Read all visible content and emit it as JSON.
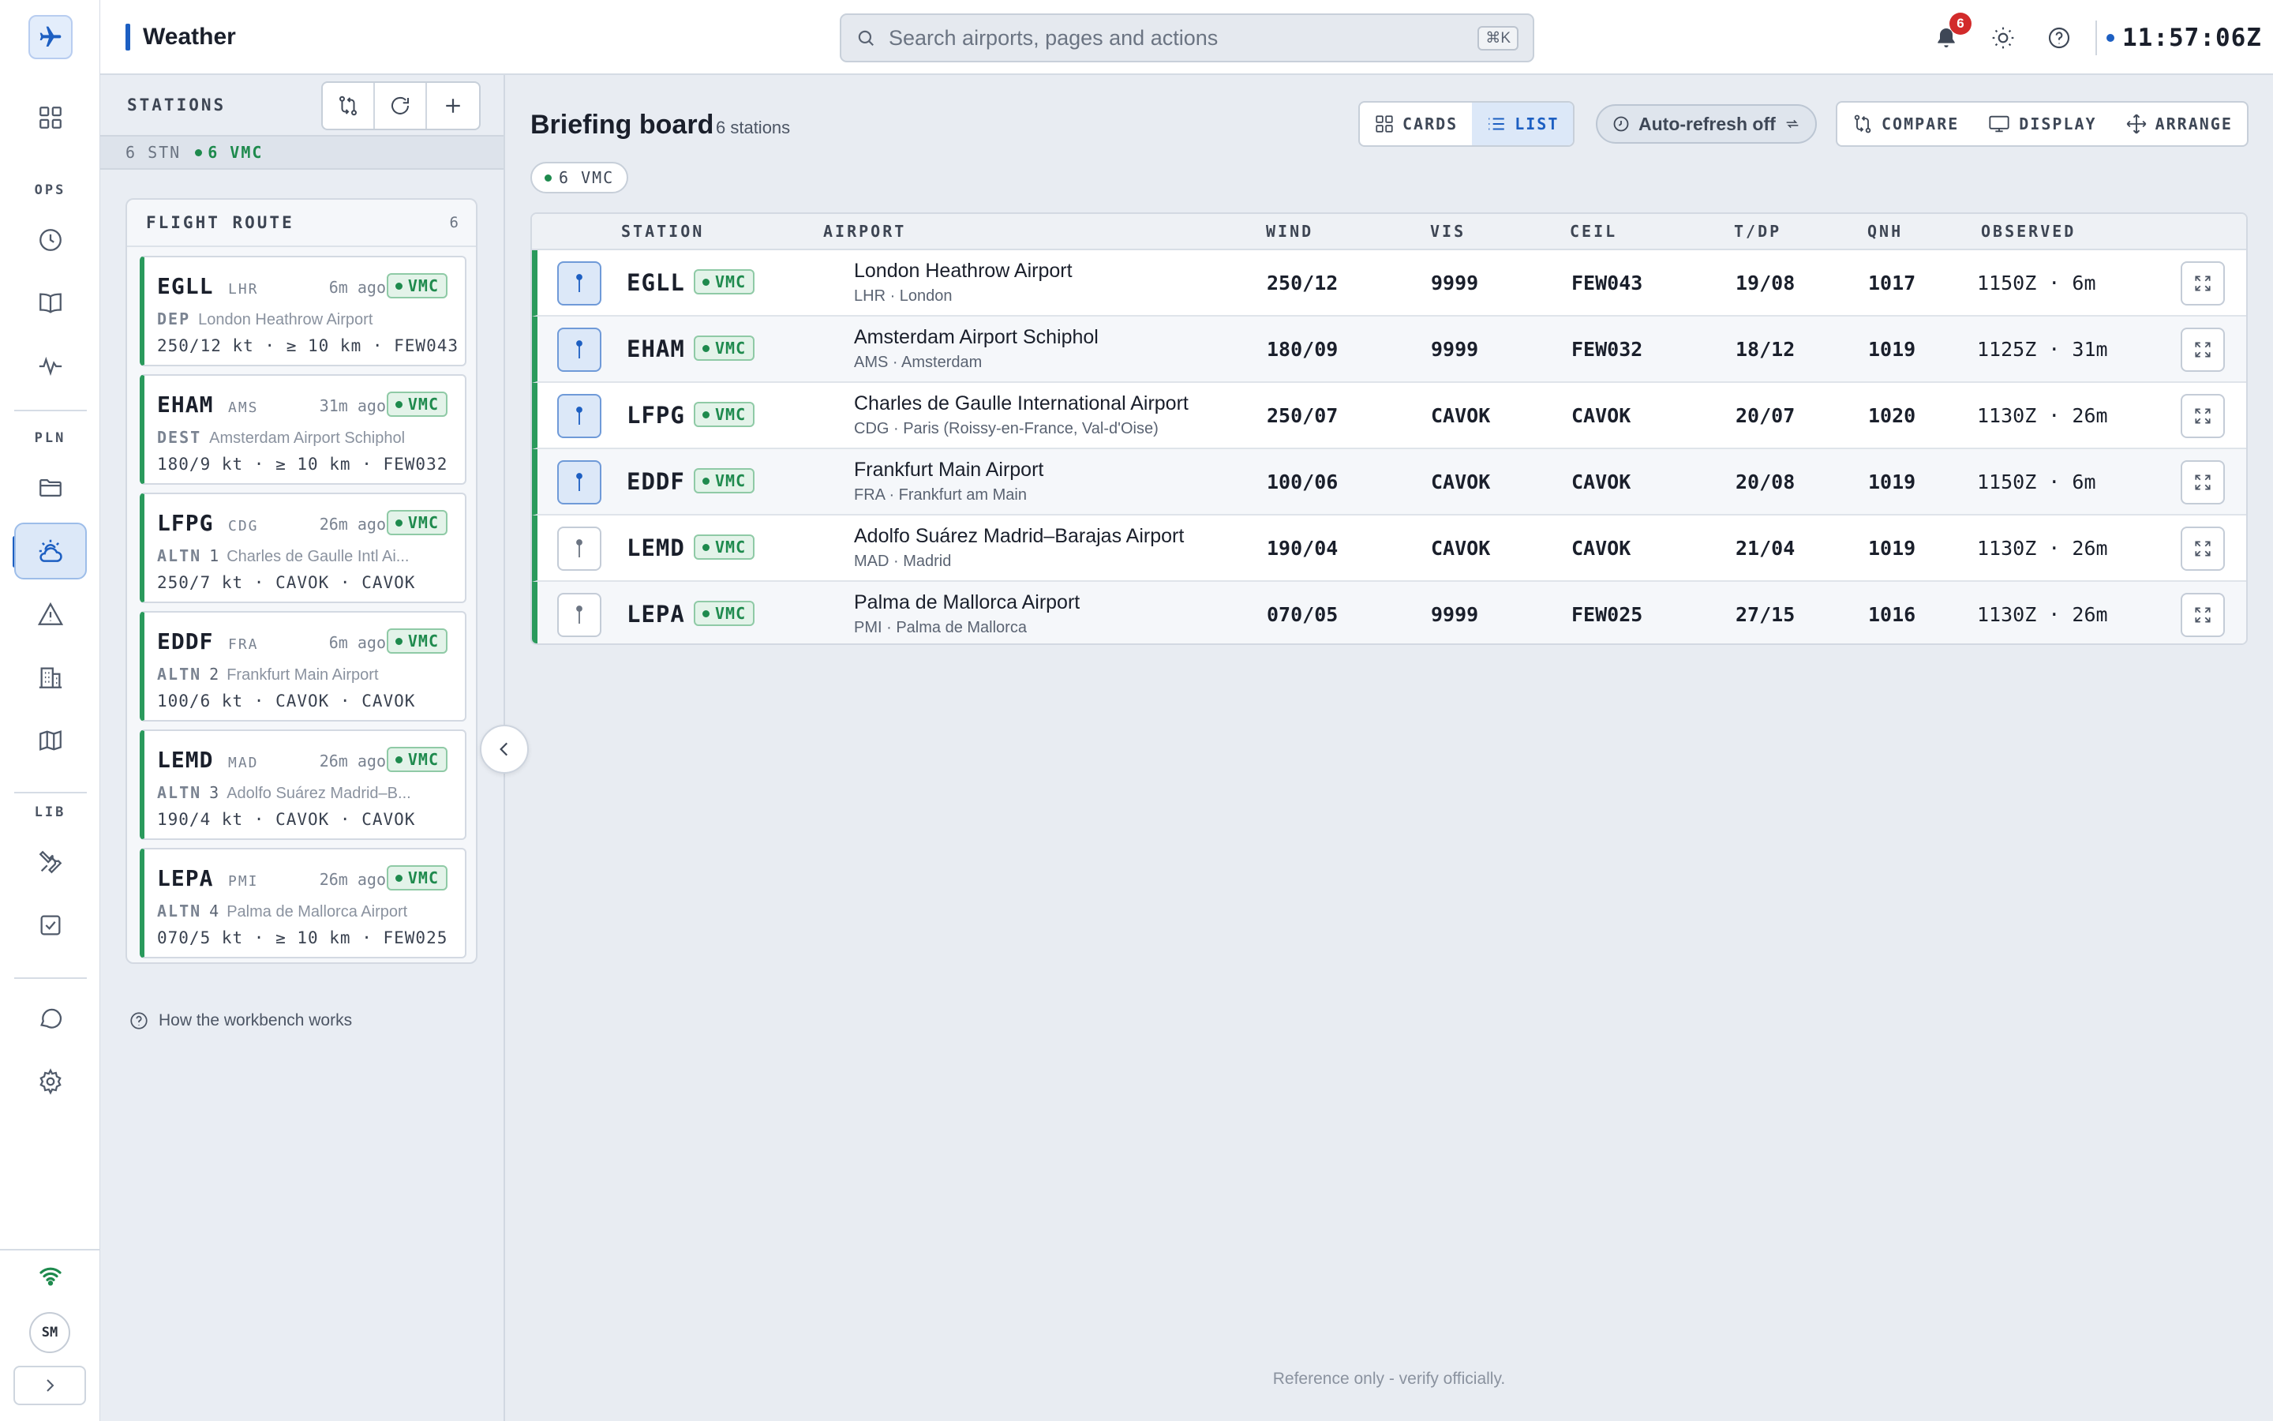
{
  "app": {
    "title": "Weather",
    "clock": "11:57:06Z",
    "notifications": "6"
  },
  "search": {
    "placeholder": "Search airports, pages and actions",
    "shortcut": "⌘K"
  },
  "rail": {
    "sections": [
      "OPS",
      "PLN",
      "LIB"
    ],
    "avatar": "SM"
  },
  "stations_panel": {
    "title": "STATIONS",
    "summary_count": "6 STN",
    "summary_vmc": "6 VMC",
    "route_title": "FLIGHT ROUTE",
    "route_count": "6",
    "help": "How the workbench works"
  },
  "route": [
    {
      "icao": "EGLL",
      "iata": "LHR",
      "ago": "6m ago",
      "cat": "VMC",
      "role": "DEP",
      "num": "",
      "name": "London Heathrow Airport",
      "met": "250/12 kt · ≥ 10 km · FEW043"
    },
    {
      "icao": "EHAM",
      "iata": "AMS",
      "ago": "31m ago",
      "cat": "VMC",
      "role": "DEST",
      "num": "",
      "name": "Amsterdam Airport Schiphol",
      "met": "180/9 kt · ≥ 10 km · FEW032"
    },
    {
      "icao": "LFPG",
      "iata": "CDG",
      "ago": "26m ago",
      "cat": "VMC",
      "role": "ALTN",
      "num": "1",
      "name": "Charles de Gaulle Intl Ai...",
      "met": "250/7 kt · CAVOK · CAVOK"
    },
    {
      "icao": "EDDF",
      "iata": "FRA",
      "ago": "6m ago",
      "cat": "VMC",
      "role": "ALTN",
      "num": "2",
      "name": "Frankfurt Main Airport",
      "met": "100/6 kt · CAVOK · CAVOK"
    },
    {
      "icao": "LEMD",
      "iata": "MAD",
      "ago": "26m ago",
      "cat": "VMC",
      "role": "ALTN",
      "num": "3",
      "name": "Adolfo Suárez Madrid–B...",
      "met": "190/4 kt · CAVOK · CAVOK"
    },
    {
      "icao": "LEPA",
      "iata": "PMI",
      "ago": "26m ago",
      "cat": "VMC",
      "role": "ALTN",
      "num": "4",
      "name": "Palma de Mallorca Airport",
      "met": "070/5 kt · ≥ 10 km · FEW025"
    }
  ],
  "board": {
    "title": "Briefing board",
    "count": "6 stations",
    "view_cards": "CARDS",
    "view_list": "LIST",
    "autorefresh": "Auto-refresh off",
    "compare": "COMPARE",
    "display": "DISPLAY",
    "arrange": "ARRANGE",
    "chip": "6 VMC",
    "columns": [
      "STATION",
      "AIRPORT",
      "WIND",
      "VIS",
      "CEIL",
      "T/DP",
      "QNH",
      "OBSERVED"
    ],
    "footer": "Reference only - verify officially."
  },
  "rows": [
    {
      "icao": "EGLL",
      "cat": "VMC",
      "name": "London Heathrow Airport",
      "loc": "LHR · London",
      "wind": "250/12",
      "vis": "9999",
      "ceil": "FEW043",
      "tdp": "19/08",
      "qnh": "1017",
      "obs": "1150Z · 6m",
      "pinned": true
    },
    {
      "icao": "EHAM",
      "cat": "VMC",
      "name": "Amsterdam Airport Schiphol",
      "loc": "AMS · Amsterdam",
      "wind": "180/09",
      "vis": "9999",
      "ceil": "FEW032",
      "tdp": "18/12",
      "qnh": "1019",
      "obs": "1125Z · 31m",
      "pinned": true
    },
    {
      "icao": "LFPG",
      "cat": "VMC",
      "name": "Charles de Gaulle International Airport",
      "loc": "CDG · Paris (Roissy-en-France, Val-d'Oise)",
      "wind": "250/07",
      "vis": "CAVOK",
      "ceil": "CAVOK",
      "tdp": "20/07",
      "qnh": "1020",
      "obs": "1130Z · 26m",
      "pinned": true
    },
    {
      "icao": "EDDF",
      "cat": "VMC",
      "name": "Frankfurt Main Airport",
      "loc": "FRA · Frankfurt am Main",
      "wind": "100/06",
      "vis": "CAVOK",
      "ceil": "CAVOK",
      "tdp": "20/08",
      "qnh": "1019",
      "obs": "1150Z · 6m",
      "pinned": true
    },
    {
      "icao": "LEMD",
      "cat": "VMC",
      "name": "Adolfo Suárez Madrid–Barajas Airport",
      "loc": "MAD · Madrid",
      "wind": "190/04",
      "vis": "CAVOK",
      "ceil": "CAVOK",
      "tdp": "21/04",
      "qnh": "1019",
      "obs": "1130Z · 26m",
      "pinned": false
    },
    {
      "icao": "LEPA",
      "cat": "VMC",
      "name": "Palma de Mallorca Airport",
      "loc": "PMI · Palma de Mallorca",
      "wind": "070/05",
      "vis": "9999",
      "ceil": "FEW025",
      "tdp": "27/15",
      "qnh": "1016",
      "obs": "1130Z · 26m",
      "pinned": false
    }
  ]
}
